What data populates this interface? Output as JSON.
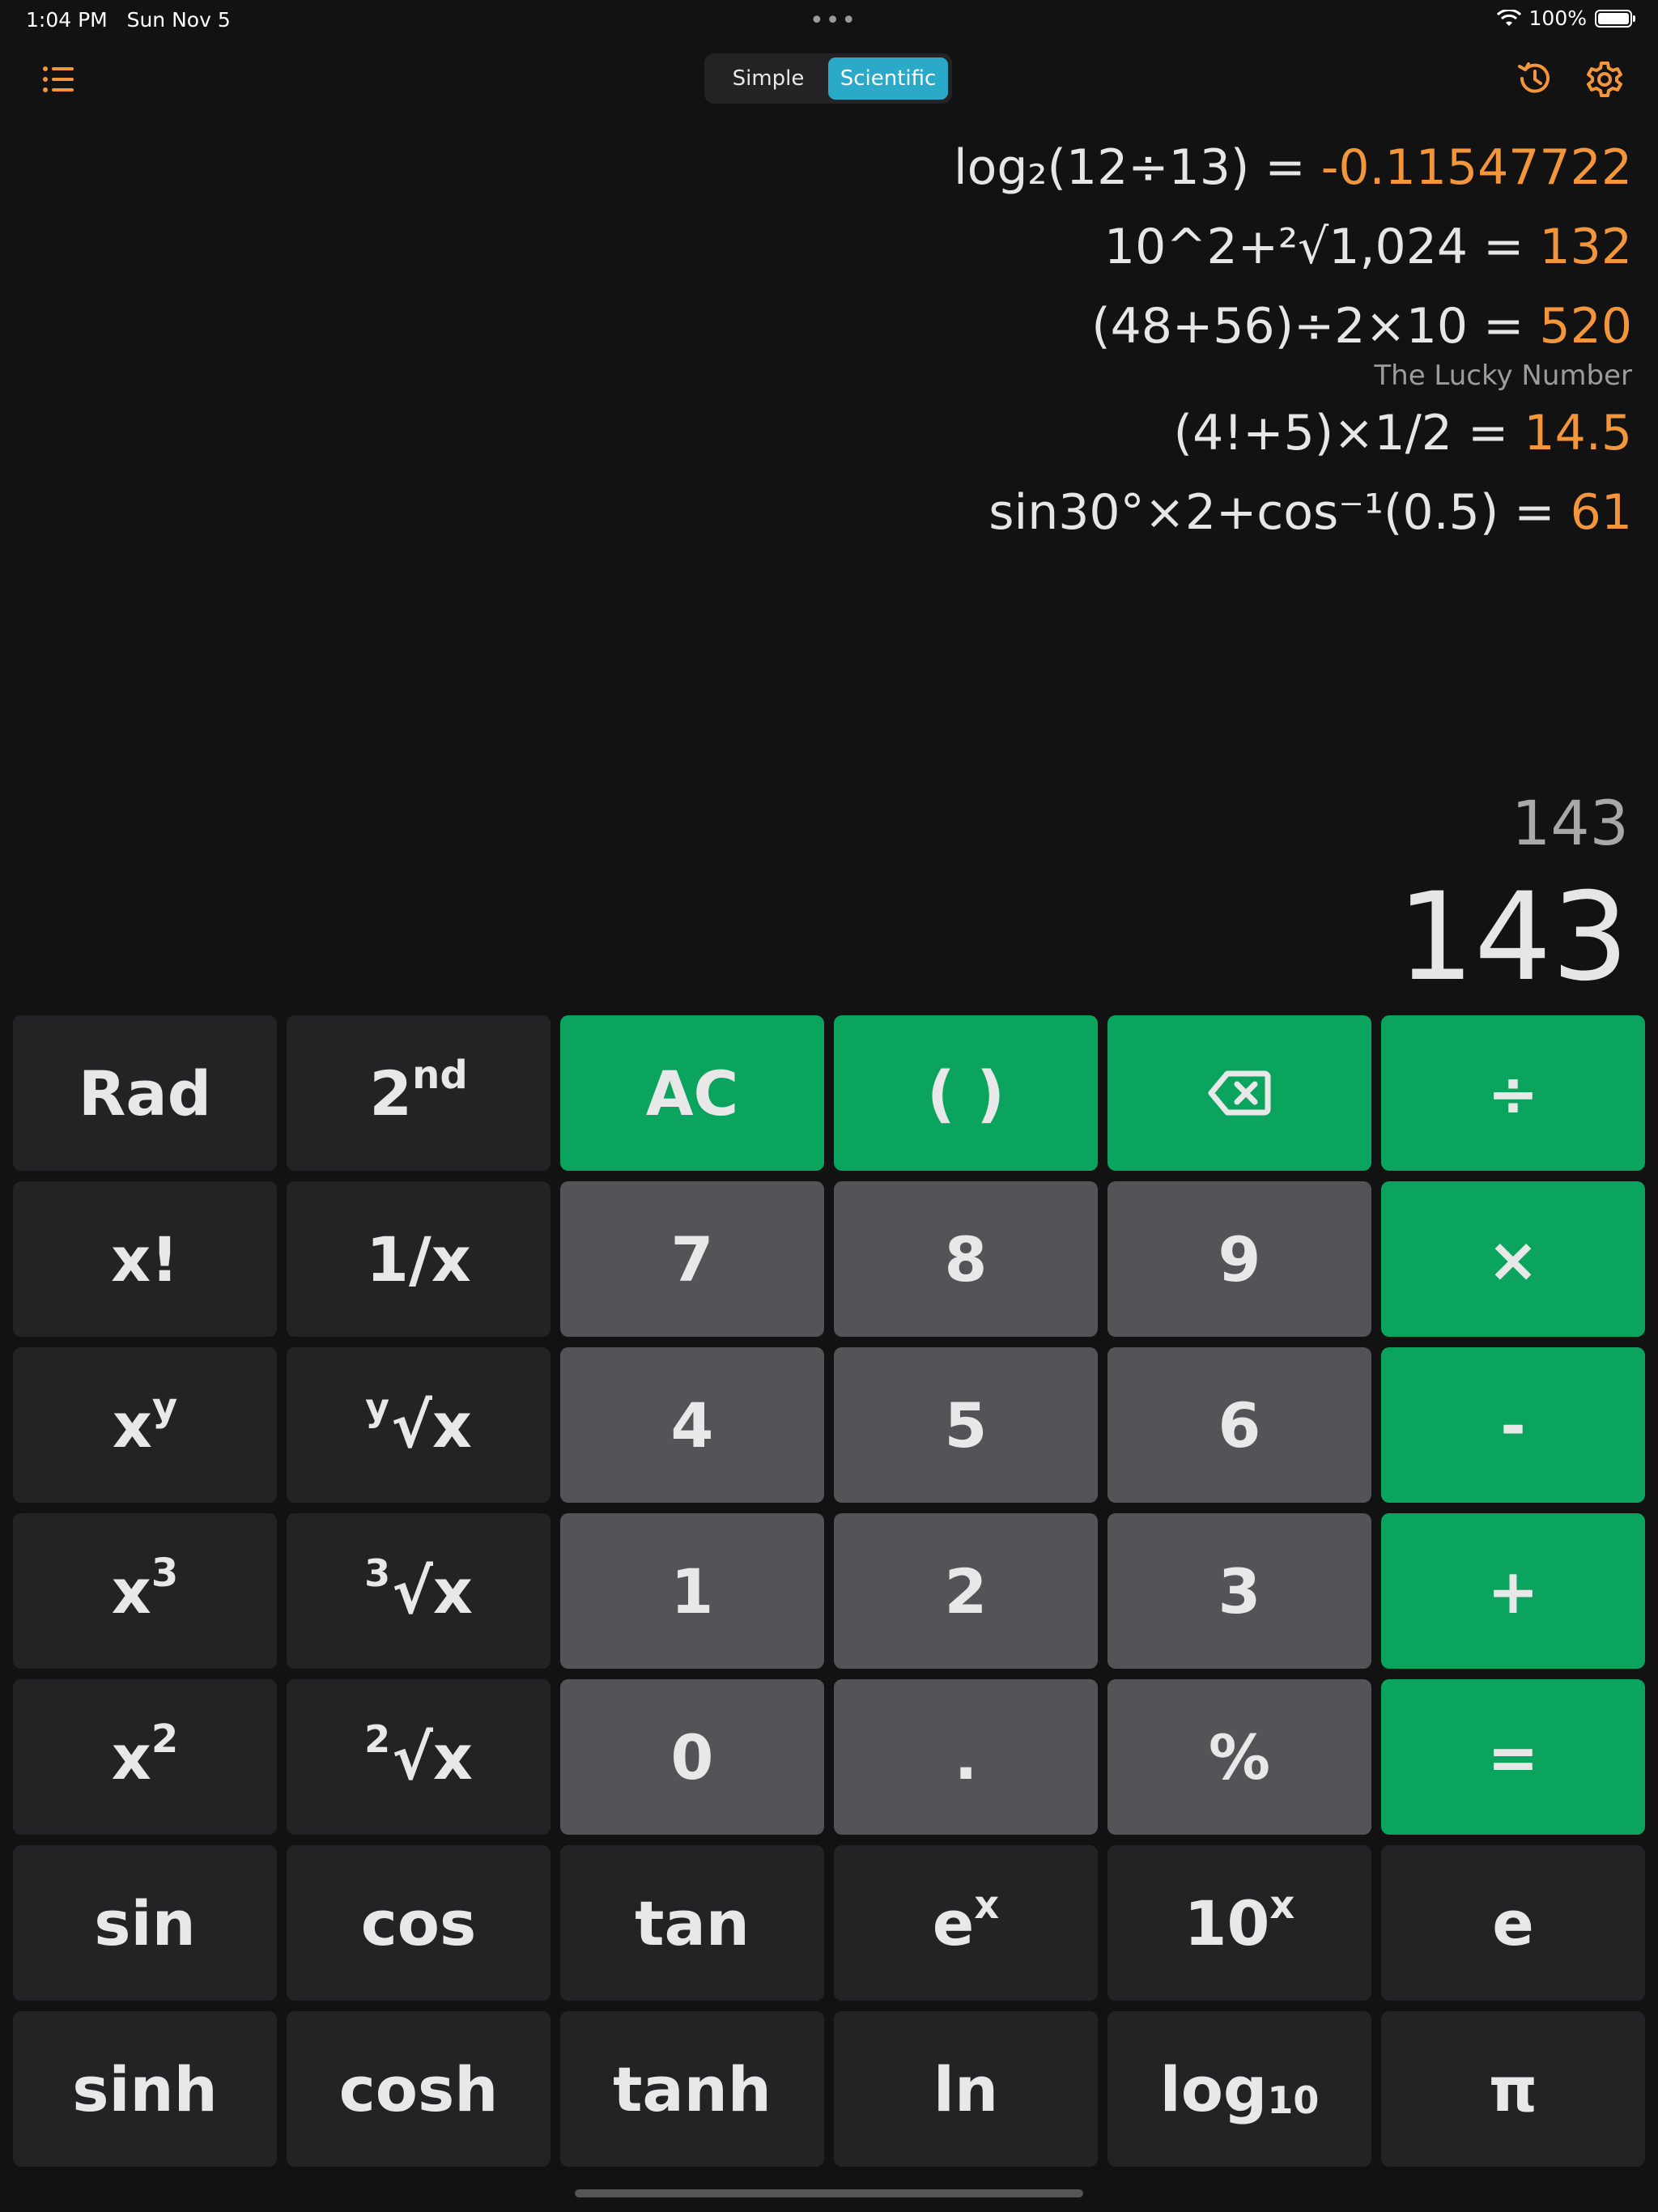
{
  "status": {
    "time": "1:04 PM",
    "date": "Sun Nov 5",
    "battery": "100%",
    "dots": "•••"
  },
  "header": {
    "segments": [
      "Simple",
      "Scientific"
    ],
    "active_segment": "Scientific",
    "icons": [
      "list-icon",
      "history-icon",
      "gear-icon"
    ]
  },
  "history": [
    {
      "expr": "log₂(12÷13) = ",
      "result": "-0.11547722"
    },
    {
      "expr": "10^2+²√1,024 = ",
      "result": "132"
    },
    {
      "expr": "(48+56)÷2×10 = ",
      "result": "520",
      "note": "The Lucky Number"
    },
    {
      "expr": "(4!+5)×1/2 = ",
      "result": "14.5"
    },
    {
      "expr": "sin30°×2+cos⁻¹(0.5) = ",
      "result": "61"
    }
  ],
  "display": {
    "expression": "143",
    "result": "143"
  },
  "keypad": {
    "rad": "Rad",
    "second": {
      "base": "2",
      "sup": "nd"
    },
    "ac": "AC",
    "parens": "( )",
    "divide": "÷",
    "factorial": "x!",
    "reciprocal": "1/x",
    "multiply": "×",
    "power": {
      "base": "x",
      "sup": "y"
    },
    "yroot": {
      "pre": "y",
      "base": "√x"
    },
    "minus": "-",
    "cube": {
      "base": "x",
      "sup": "3"
    },
    "cuberoot": {
      "pre": "3",
      "base": "√x"
    },
    "plus": "+",
    "square": {
      "base": "x",
      "sup": "2"
    },
    "sqrt": {
      "pre": "2",
      "base": "√x"
    },
    "equals": "=",
    "digits": [
      "7",
      "8",
      "9",
      "4",
      "5",
      "6",
      "1",
      "2",
      "3",
      "0",
      ".",
      "%"
    ],
    "sin": "sin",
    "cos": "cos",
    "tan": "tan",
    "exp": {
      "base": "e",
      "sup": "x"
    },
    "pow10": {
      "base": "10",
      "sup": "x"
    },
    "e": "e",
    "sinh": "sinh",
    "cosh": "cosh",
    "tanh": "tanh",
    "ln": "ln",
    "log10": {
      "base": "log",
      "sub": "10"
    },
    "pi": "π"
  },
  "colors": {
    "background": "#121212",
    "accent_green": "#0ba45f",
    "accent_orange": "#f3953a",
    "segment_active": "#2aa9c9"
  }
}
